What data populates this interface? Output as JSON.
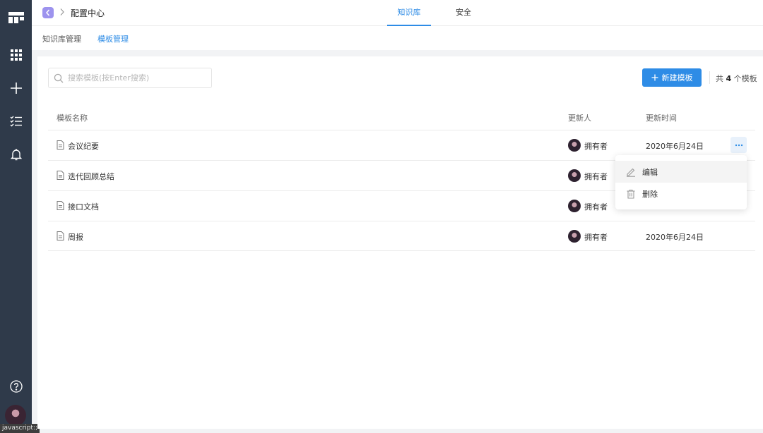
{
  "sidebar": {
    "items": [
      {
        "icon": "logo-icon"
      },
      {
        "icon": "apps-grid-icon"
      },
      {
        "icon": "plus-icon"
      },
      {
        "icon": "task-list-icon"
      },
      {
        "icon": "bell-icon"
      }
    ],
    "bottom": [
      {
        "icon": "help-icon"
      },
      {
        "icon": "avatar"
      }
    ],
    "status_tip": "javascript:;"
  },
  "header": {
    "title": "配置中心",
    "tabs": [
      {
        "label": "知识库",
        "active": true
      },
      {
        "label": "安全",
        "active": false
      }
    ]
  },
  "subnav": {
    "tabs": [
      {
        "label": "知识库管理",
        "active": false
      },
      {
        "label": "模板管理",
        "active": true
      }
    ]
  },
  "toolbar": {
    "search_placeholder": "搜索模板(按Enter搜索)",
    "new_button_label": "新建模板",
    "count_prefix": "共",
    "count_value": "4",
    "count_suffix": "个模板"
  },
  "table": {
    "columns": [
      "模板名称",
      "更新人",
      "更新时间"
    ],
    "rows": [
      {
        "name": "会议纪要",
        "updater": "拥有者",
        "updated": "2020年6月24日"
      },
      {
        "name": "迭代回顾总结",
        "updater": "拥有者",
        "updated": ""
      },
      {
        "name": "接口文档",
        "updater": "拥有者",
        "updated": ""
      },
      {
        "name": "周报",
        "updater": "拥有者",
        "updated": "2020年6月24日"
      }
    ]
  },
  "dropdown": {
    "items": [
      {
        "label": "编辑",
        "icon": "edit-icon"
      },
      {
        "label": "删除",
        "icon": "trash-icon"
      }
    ]
  },
  "colors": {
    "accent": "#2e8ce6",
    "sidebar_bg": "#2f3a4a",
    "back_button": "#9d93ee"
  }
}
